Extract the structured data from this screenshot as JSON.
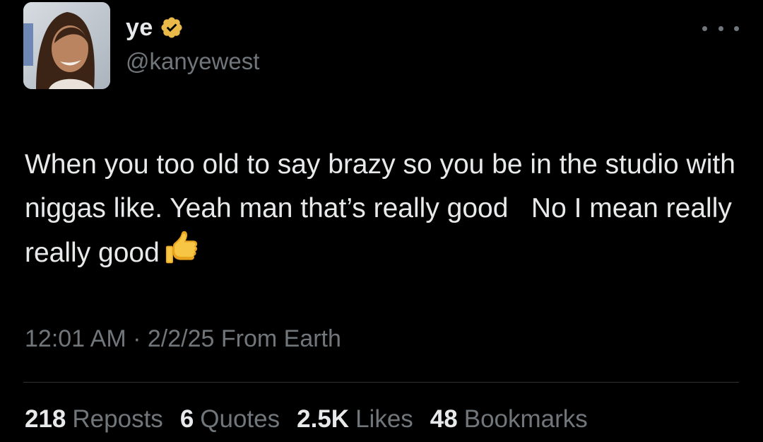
{
  "colors": {
    "background": "#000000",
    "text_primary": "#e7e9ea",
    "text_secondary": "#71767b",
    "divider": "#2f3336",
    "verified_badge": "#e9b949"
  },
  "author": {
    "display_name": "ye",
    "handle": "@kanyewest",
    "verified_icon": "gold-verified-badge-icon",
    "avatar_icon": "profile-photo"
  },
  "tweet": {
    "text": "When you too old to say brazy so you be in the studio with niggas like. Yeah man that’s really good   No I mean really really good",
    "emoji": "thumbs-up-icon",
    "time": "12:01 AM",
    "separator": "·",
    "date": "2/2/25",
    "source": "From Earth"
  },
  "stats": [
    {
      "count": "218",
      "label": "Reposts"
    },
    {
      "count": "6",
      "label": "Quotes"
    },
    {
      "count": "2.5K",
      "label": "Likes"
    },
    {
      "count": "48",
      "label": "Bookmarks"
    }
  ]
}
